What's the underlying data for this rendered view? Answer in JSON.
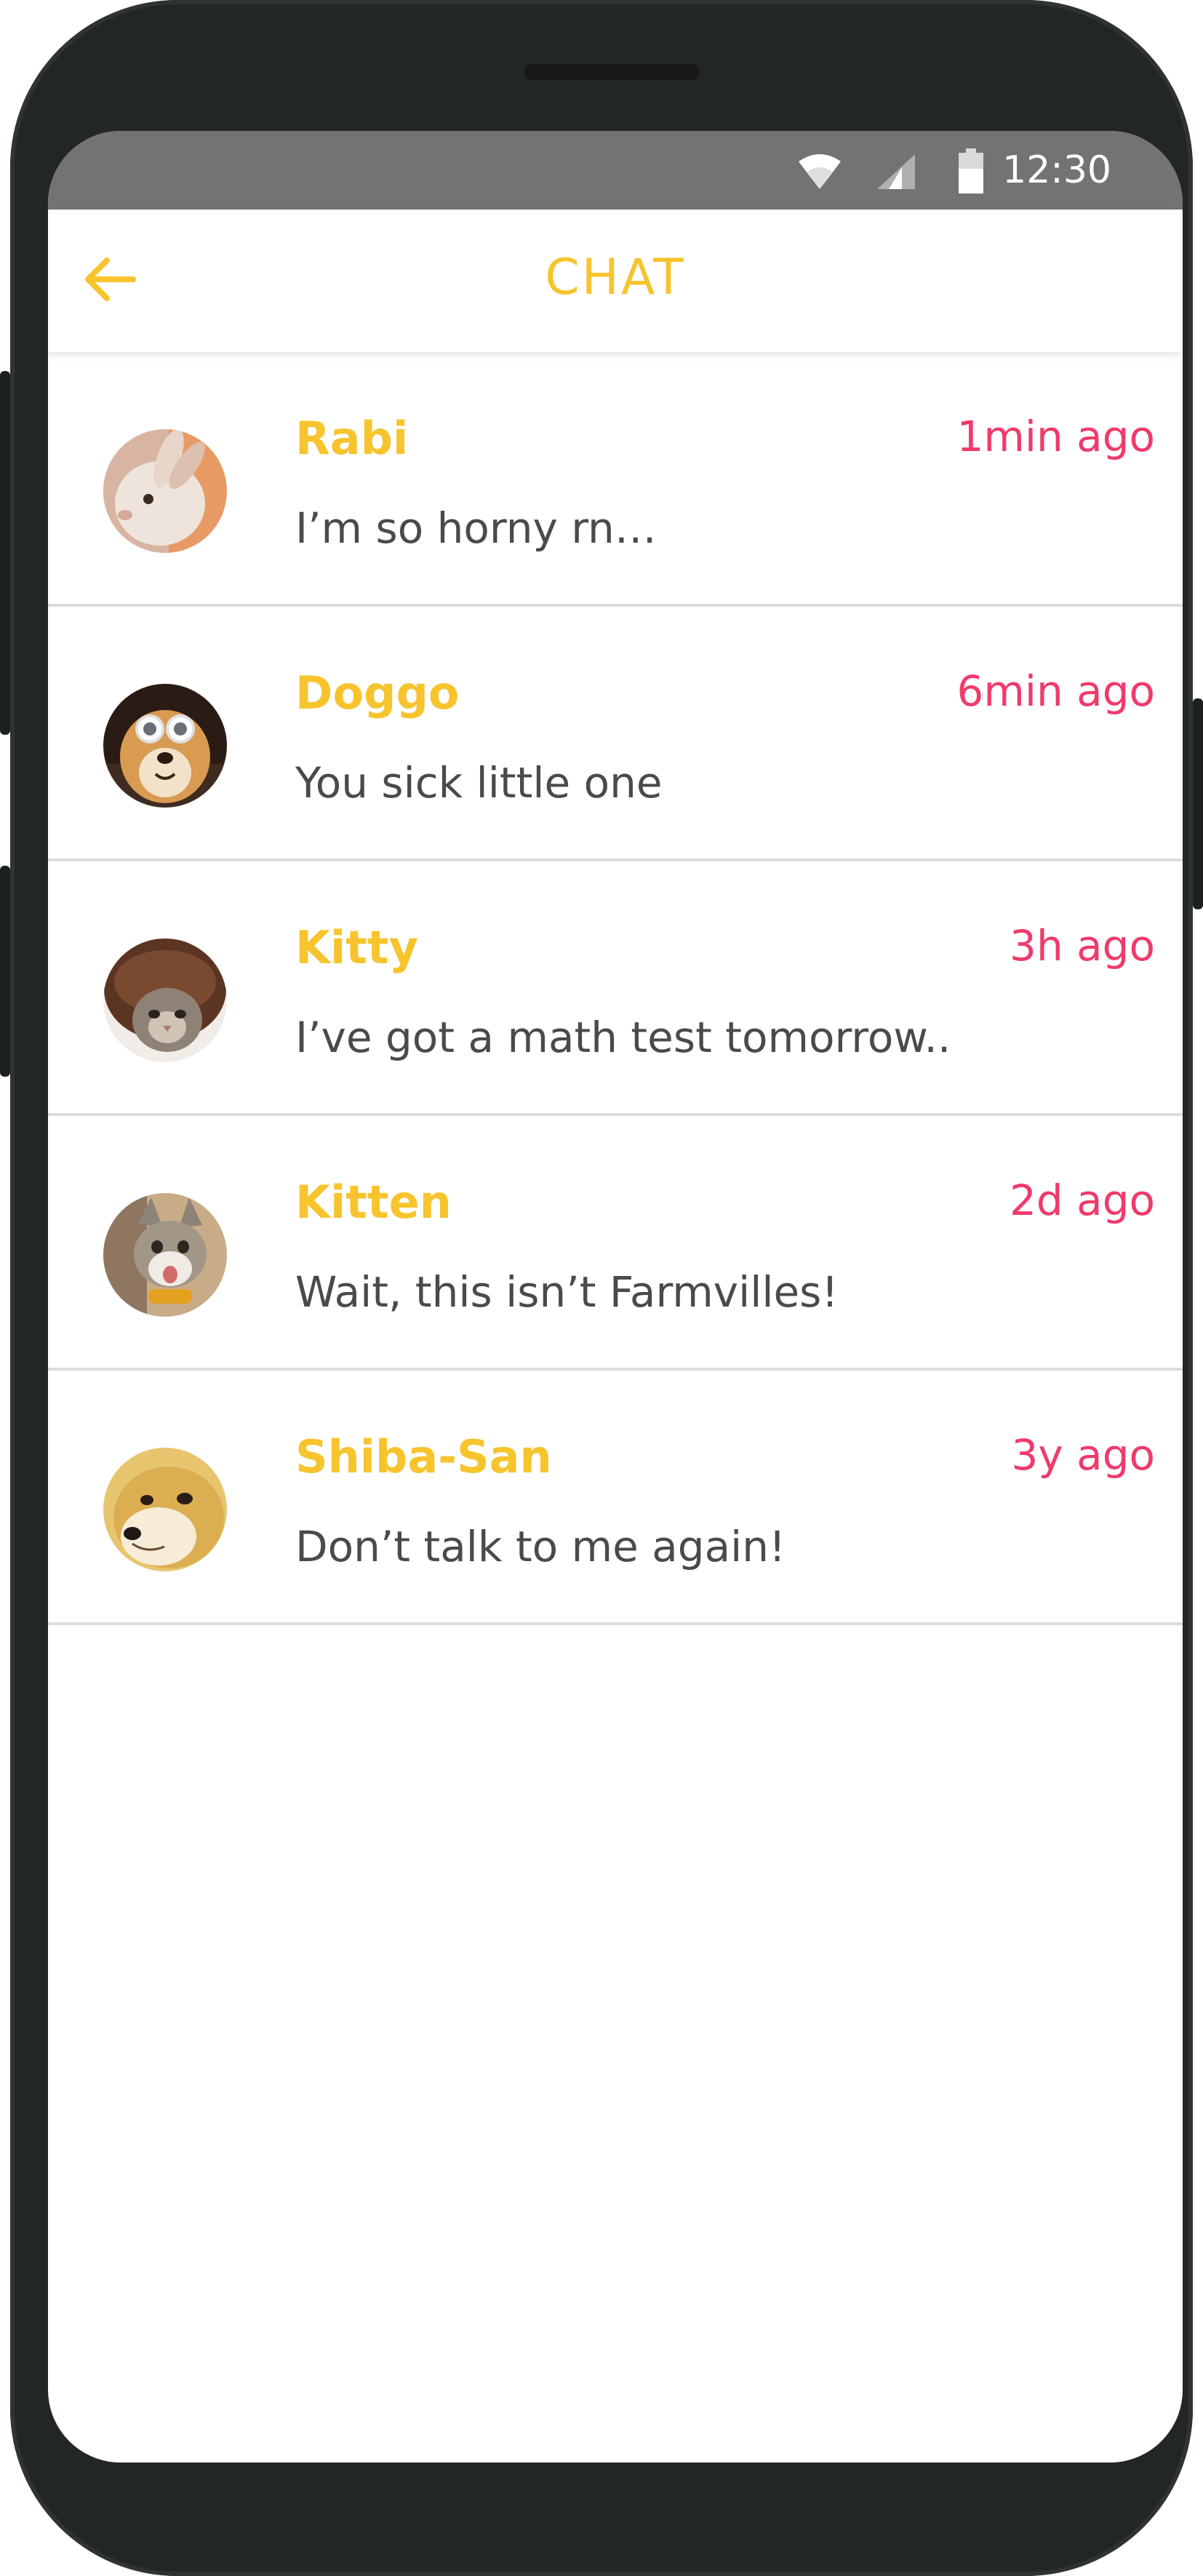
{
  "status_bar": {
    "time": "12:30",
    "icons": [
      "wifi-icon",
      "signal-icon",
      "battery-icon"
    ]
  },
  "app_bar": {
    "title": "CHAT",
    "back_icon": "arrow-left-icon"
  },
  "colors": {
    "accent": "#f7c42e",
    "timestamp": "#f03a6a",
    "status_bar": "#737373",
    "preview_text": "#4a4a4a"
  },
  "chats": [
    {
      "name": "Rabi",
      "time": "1min ago",
      "preview": "I’m so horny rn…",
      "avatar": "rabbit-avatar"
    },
    {
      "name": "Doggo",
      "time": "6min ago",
      "preview": "You sick little one",
      "avatar": "dog-sunglasses-avatar"
    },
    {
      "name": "Kitty",
      "time": "3h ago",
      "preview": "I’ve got a math test tomorrow..",
      "avatar": "cat-in-hat-avatar"
    },
    {
      "name": "Kitten",
      "time": "2d ago",
      "preview": "Wait, this isn’t Farmvilles!",
      "avatar": "kitten-avatar"
    },
    {
      "name": "Shiba-San",
      "time": "3y ago",
      "preview": "Don’t talk to me again!",
      "avatar": "shiba-avatar"
    }
  ]
}
